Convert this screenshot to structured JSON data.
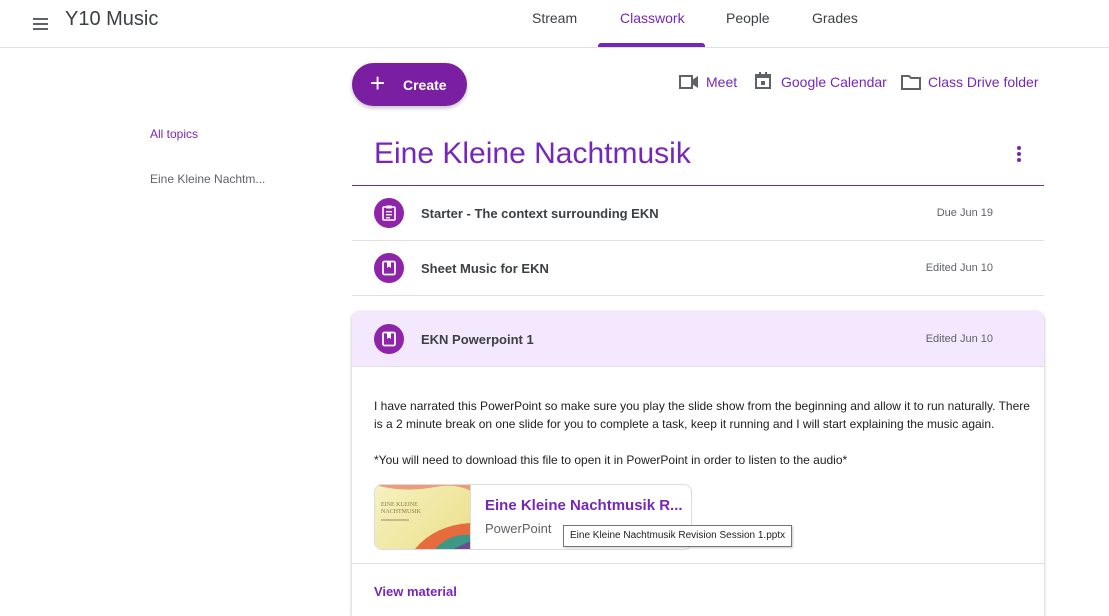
{
  "app": {
    "title": "Y10 Music"
  },
  "tabs": [
    {
      "label": "Stream"
    },
    {
      "label": "Classwork"
    },
    {
      "label": "People"
    },
    {
      "label": "Grades"
    }
  ],
  "active_tab": "Classwork",
  "toolbar": {
    "create_label": "Create",
    "meet_label": "Meet",
    "calendar_label": "Google Calendar",
    "drive_label": "Class Drive folder"
  },
  "sidebar": {
    "all_topics": "All topics",
    "items": [
      {
        "label": "Eine Kleine Nachtm..."
      }
    ]
  },
  "topic": {
    "title": "Eine Kleine Nachtmusik",
    "items": [
      {
        "title": "Starter - The context surrounding EKN",
        "date": "Due Jun 19",
        "icon": "assignment-icon"
      },
      {
        "title": "Sheet Music for EKN",
        "date": "Edited Jun 10",
        "icon": "material-icon"
      },
      {
        "title": "EKN Powerpoint 1",
        "date": "Edited Jun 10",
        "icon": "material-icon"
      }
    ]
  },
  "expanded": {
    "description_1": "I have narrated this PowerPoint so make sure you play the slide show from the beginning and allow it to run naturally.  There is a 2 minute break on one slide for you to complete a task, keep it running and I will start explaining the music again.",
    "description_2": "*You will need to download this file to open it in PowerPoint in order to listen to the audio*",
    "attachment": {
      "title": "Eine Kleine Nachtmusik R...",
      "type": "PowerPoint",
      "thumb_title": "EINE KLEINE\nNACHTMUSIK",
      "tooltip": "Eine Kleine Nachtmusik Revision Session 1.pptx"
    },
    "view_material": "View material"
  },
  "colors": {
    "accent": "#7627bb",
    "create_button": "#7b1fa2",
    "icon_circle": "#8e24aa",
    "expanded_header": "#f3e8fd"
  }
}
